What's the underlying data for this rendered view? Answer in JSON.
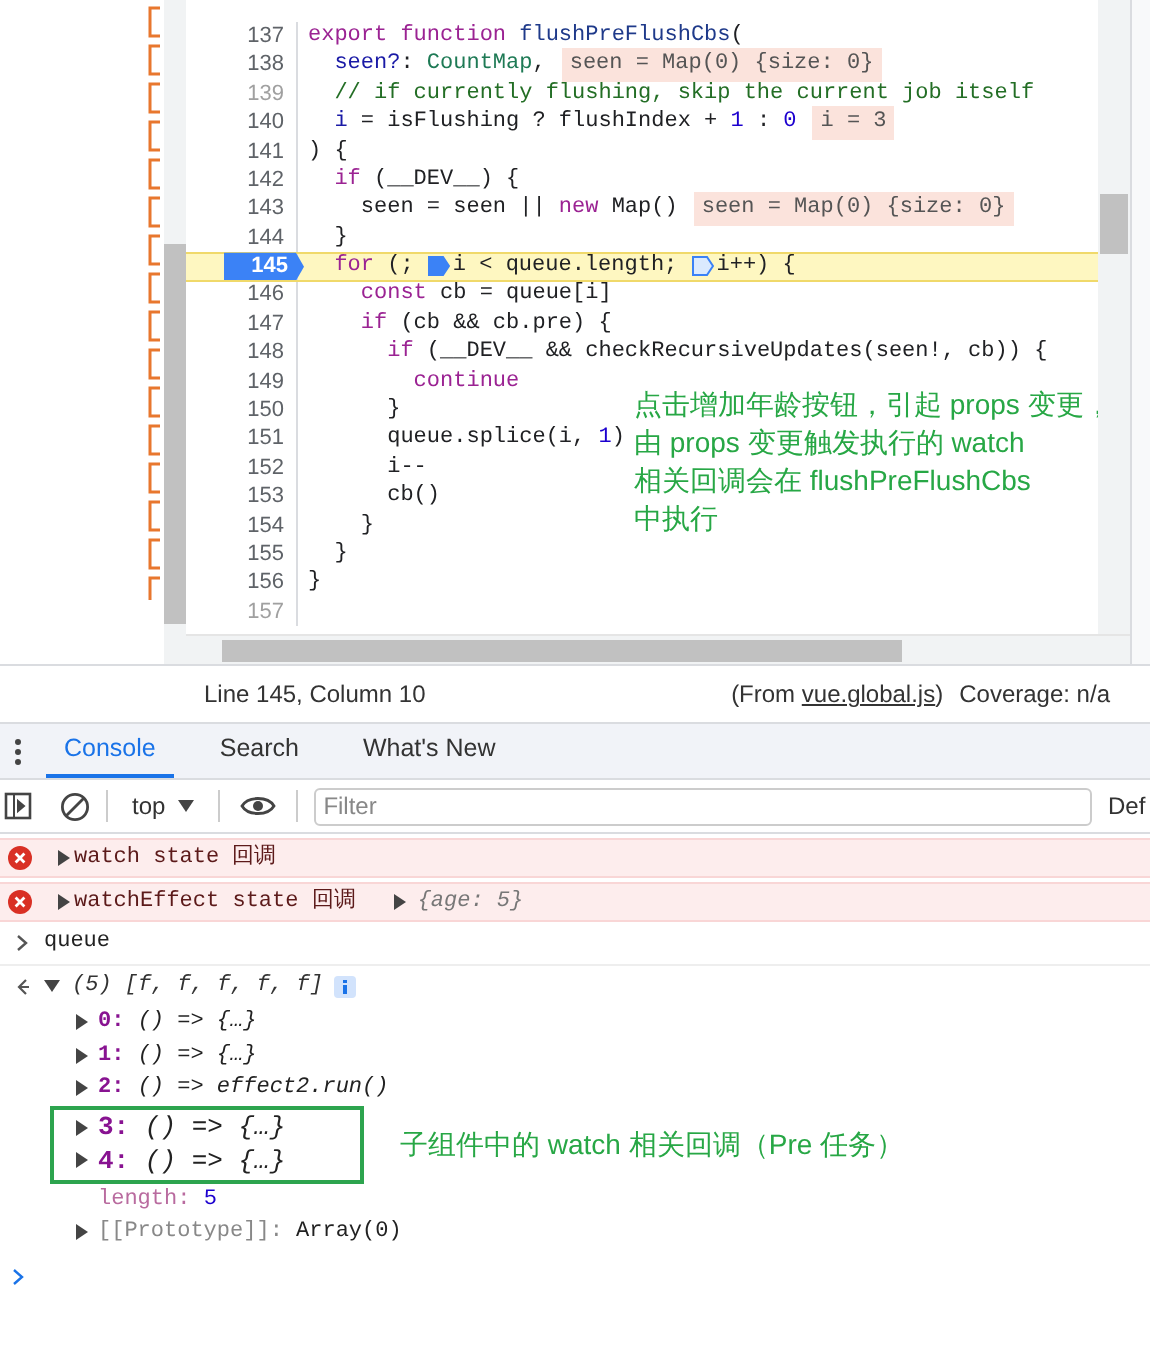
{
  "editor": {
    "lines": [
      {
        "number": "137",
        "muted": false,
        "current": false,
        "tokens": [
          {
            "kind": "kw",
            "t": "export function "
          },
          {
            "kind": "def",
            "t": "flushPreFlushCbs"
          },
          {
            "kind": "plain",
            "t": "("
          }
        ]
      },
      {
        "number": "138",
        "muted": false,
        "current": false,
        "tokens": [
          {
            "kind": "var",
            "t": "  seen?"
          },
          {
            "kind": "plain",
            "t": ": "
          },
          {
            "kind": "type",
            "t": "CountMap"
          },
          {
            "kind": "plain",
            "t": ","
          }
        ],
        "value": "seen = Map(0) {size: 0}"
      },
      {
        "number": "139",
        "muted": true,
        "current": false,
        "tokens": [
          {
            "kind": "comment",
            "t": "  // if currently flushing, skip the current job itself"
          }
        ]
      },
      {
        "number": "140",
        "muted": false,
        "current": false,
        "tokens": [
          {
            "kind": "var",
            "t": "  i"
          },
          {
            "kind": "plain",
            "t": " = isFlushing ? flushIndex + "
          },
          {
            "kind": "num",
            "t": "1"
          },
          {
            "kind": "plain",
            "t": " : "
          },
          {
            "kind": "num",
            "t": "0"
          }
        ],
        "value": "i = 3"
      },
      {
        "number": "141",
        "muted": false,
        "current": false,
        "tokens": [
          {
            "kind": "plain",
            "t": ") {"
          }
        ]
      },
      {
        "number": "142",
        "muted": false,
        "current": false,
        "tokens": [
          {
            "kind": "kw",
            "t": "  if"
          },
          {
            "kind": "plain",
            "t": " (__DEV__) {"
          }
        ]
      },
      {
        "number": "143",
        "muted": false,
        "current": false,
        "tokens": [
          {
            "kind": "plain",
            "t": "    seen = seen || "
          },
          {
            "kind": "kw",
            "t": "new"
          },
          {
            "kind": "plain",
            "t": " Map()"
          }
        ],
        "value": "seen = Map(0) {size: 0}"
      },
      {
        "number": "144",
        "muted": false,
        "current": false,
        "tokens": [
          {
            "kind": "plain",
            "t": "  }"
          }
        ]
      },
      {
        "number": "145",
        "muted": false,
        "current": true,
        "tokens": [
          {
            "kind": "kw",
            "t": "  for"
          },
          {
            "kind": "plain",
            "t": " (; "
          },
          {
            "kind": "bp",
            "on": true
          },
          {
            "kind": "plain",
            "t": "i < queue.length; "
          },
          {
            "kind": "bp",
            "on": false
          },
          {
            "kind": "plain",
            "t": "i++) {"
          }
        ]
      },
      {
        "number": "146",
        "muted": false,
        "current": false,
        "tokens": [
          {
            "kind": "kw",
            "t": "    const"
          },
          {
            "kind": "plain",
            "t": " cb = queue[i]"
          }
        ]
      },
      {
        "number": "147",
        "muted": false,
        "current": false,
        "tokens": [
          {
            "kind": "kw",
            "t": "    if"
          },
          {
            "kind": "plain",
            "t": " (cb && cb.pre) {"
          }
        ]
      },
      {
        "number": "148",
        "muted": false,
        "current": false,
        "tokens": [
          {
            "kind": "kw",
            "t": "      if"
          },
          {
            "kind": "plain",
            "t": " (__DEV__ && checkRecursiveUpdates(seen!, cb)) {"
          }
        ]
      },
      {
        "number": "149",
        "muted": false,
        "current": false,
        "tokens": [
          {
            "kind": "kw",
            "t": "        continue"
          }
        ]
      },
      {
        "number": "150",
        "muted": false,
        "current": false,
        "tokens": [
          {
            "kind": "plain",
            "t": "      }"
          }
        ]
      },
      {
        "number": "151",
        "muted": false,
        "current": false,
        "tokens": [
          {
            "kind": "plain",
            "t": "      queue.splice(i, "
          },
          {
            "kind": "num",
            "t": "1"
          },
          {
            "kind": "plain",
            "t": ")"
          }
        ]
      },
      {
        "number": "152",
        "muted": false,
        "current": false,
        "tokens": [
          {
            "kind": "plain",
            "t": "      i--"
          }
        ]
      },
      {
        "number": "153",
        "muted": false,
        "current": false,
        "tokens": [
          {
            "kind": "plain",
            "t": "      cb()"
          }
        ]
      },
      {
        "number": "154",
        "muted": false,
        "current": false,
        "tokens": [
          {
            "kind": "plain",
            "t": "    }"
          }
        ]
      },
      {
        "number": "155",
        "muted": false,
        "current": false,
        "tokens": [
          {
            "kind": "plain",
            "t": "  }"
          }
        ]
      },
      {
        "number": "156",
        "muted": false,
        "current": false,
        "tokens": [
          {
            "kind": "plain",
            "t": "}"
          }
        ]
      },
      {
        "number": "157",
        "muted": true,
        "current": false
      }
    ],
    "note": [
      "点击增加年龄按钮，引起 props 变更，",
      "由 props 变更触发执行的 watch",
      "相关回调会在 flushPreFlushCbs",
      "中执行"
    ]
  },
  "status_bar": {
    "position": "Line 145, Column 10",
    "source_prefix": "(From ",
    "source_file": "vue.global.js",
    "source_suffix": ")",
    "coverage": "Coverage: n/a"
  },
  "drawer": {
    "tabs": [
      {
        "label": "Console",
        "selected": true
      },
      {
        "label": "Search",
        "selected": false
      },
      {
        "label": "What's New",
        "selected": false
      }
    ],
    "toolbar": {
      "context": "top",
      "filter_placeholder": "Filter",
      "levels": "Def"
    },
    "messages": [
      {
        "kind": "error",
        "text": "watch state 回调"
      },
      {
        "kind": "error",
        "text": "watchEffect state 回调",
        "object": "{age: 5}"
      },
      {
        "kind": "input",
        "text": "queue"
      },
      {
        "kind": "output",
        "summary": "(5) [f, f, f, f, f]",
        "expanded": true,
        "children": [
          {
            "kind": "entry",
            "key": "0:",
            "value": "() => {…}",
            "highlight": false
          },
          {
            "kind": "entry",
            "key": "1:",
            "value": "() => {…}",
            "highlight": false
          },
          {
            "kind": "entry",
            "key": "2:",
            "value": "() => effect2.run()",
            "highlight": false
          },
          {
            "kind": "entry",
            "key": "3:",
            "value": "() => {…}",
            "highlight": true
          },
          {
            "kind": "entry",
            "key": "4:",
            "value": "() => {…}",
            "highlight": true
          },
          {
            "kind": "meta",
            "key": "length:",
            "value": "5",
            "highlight": false
          },
          {
            "kind": "proto",
            "key": "[[Prototype]]:",
            "value": "Array(0)",
            "highlight": false
          }
        ],
        "note": "子组件中的 watch 相关回调（Pre 任务）"
      },
      {
        "kind": "prompt"
      }
    ]
  }
}
